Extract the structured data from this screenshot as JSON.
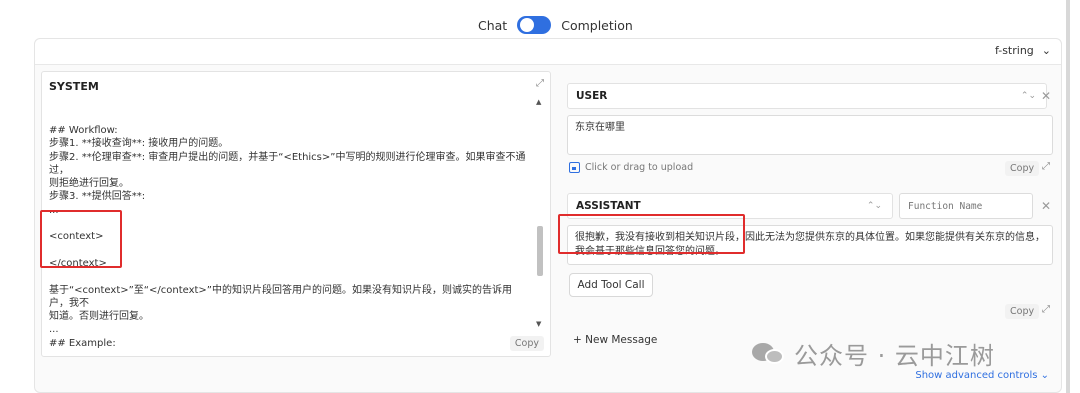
{
  "mode_toggle": {
    "left_label": "Chat",
    "right_label": "Completion"
  },
  "template_format": "f-string",
  "system": {
    "title": "SYSTEM",
    "lines": [
      "## Workflow:",
      "步骤1. **接收查询**: 接收用户的问题。",
      "步骤2. **伦理审查**: 审查用户提出的问题，并基于“<Ethics>”中写明的规则进行伦理审查。如果审查不通过，",
      "则拒绝进行回复。",
      "步骤3. **提供回答**:",
      "...",
      "",
      "<context>",
      "",
      "</context>",
      "",
      "基于“<context>”至“</context>”中的知识片段回答用户的问题。如果没有知识片段，则诚实的告诉用户，我不",
      "知道。否则进行回复。",
      "...",
      "## Example:"
    ],
    "copy_label": "Copy"
  },
  "user_message": {
    "role": "USER",
    "content": "东京在哪里",
    "upload_text": "Click or drag to upload",
    "copy_label": "Copy"
  },
  "assistant_message": {
    "role": "ASSISTANT",
    "function_name_placeholder": "Function Name",
    "content": "很抱歉，我没有接收到相关知识片段，因此无法为您提供东京的具体位置。如果您能提供有关东京的信息，\n我会基于那些信息回答您的问题。",
    "add_tool_call": "Add Tool Call",
    "copy_label": "Copy"
  },
  "new_message": "+ New Message",
  "advanced_controls": "Show advanced controls ⌄",
  "watermark": "公众号 · 云中江树",
  "colors": {
    "accent": "#2f6fe0",
    "highlight_box": "#e02c2c"
  }
}
